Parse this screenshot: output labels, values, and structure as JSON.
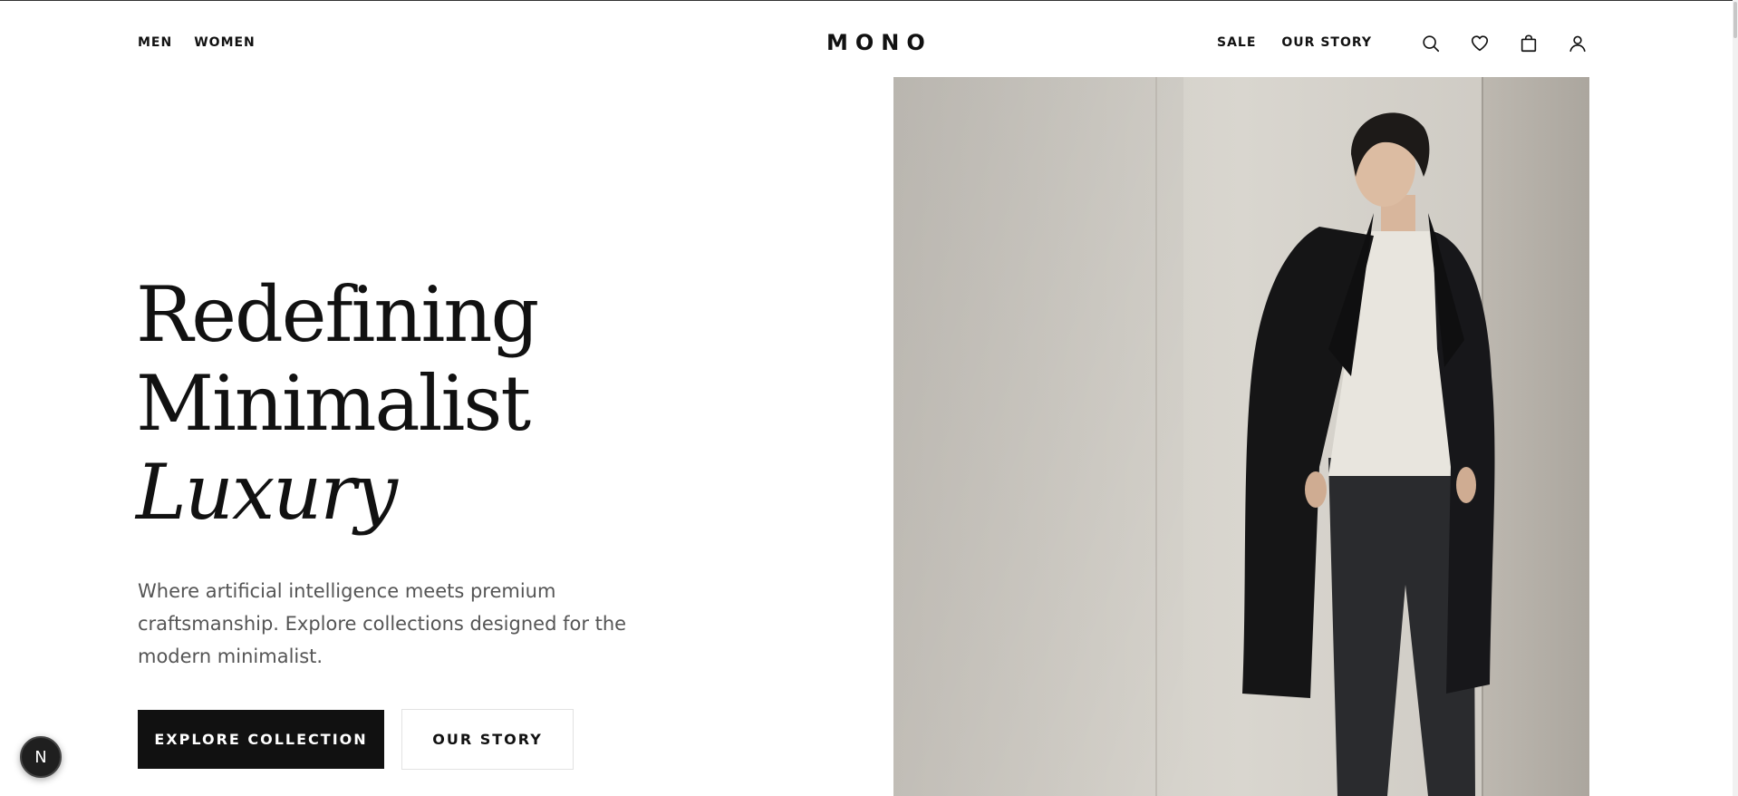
{
  "header": {
    "nav_left": [
      "MEN",
      "WOMEN"
    ],
    "logo": "MONO",
    "nav_right": [
      "SALE",
      "OUR STORY"
    ],
    "icons": [
      "search-icon",
      "heart-icon",
      "shopping-bag-icon",
      "user-icon"
    ]
  },
  "hero": {
    "title_line1": "Redefining",
    "title_line2": "Minimalist",
    "title_line3": "Luxury",
    "subtitle": "Where artificial intelligence meets premium craftsmanship. Explore collections designed for the modern minimalist.",
    "primary_button": "EXPLORE COLLECTION",
    "secondary_button": "OUR STORY"
  },
  "badge": {
    "label": "N"
  },
  "colors": {
    "text": "#111111",
    "muted": "#555555",
    "primary_bg": "#111111",
    "image_bg": "#d5d2cc"
  }
}
